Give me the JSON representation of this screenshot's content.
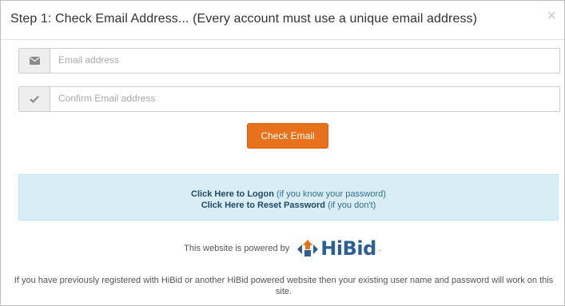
{
  "header": {
    "title": "Step 1: Check Email Address... (Every account must use a unique email address)",
    "close_label": "×"
  },
  "form": {
    "email": {
      "placeholder": "Email address",
      "value": "",
      "icon": "envelope-icon"
    },
    "confirm_email": {
      "placeholder": "Confirm Email address",
      "value": "",
      "icon": "check-icon"
    },
    "check_button_label": "Check Email"
  },
  "info": {
    "logon_link": "Click Here to Logon",
    "logon_note": "(if you know your password)",
    "reset_link": "Click Here to Reset Password",
    "reset_note": "(if you don't)"
  },
  "powered": {
    "text": "This website is powered by",
    "brand": "HiBid",
    "suffix": "."
  },
  "footer": {
    "note": "If you have previously registered with HiBid or another HiBid powered website then your existing user name and password will work on this site."
  },
  "colors": {
    "button_orange": "#e8711c",
    "info_background": "#d9edf7",
    "info_text": "#31708f",
    "brand_blue": "#2d5f95"
  }
}
